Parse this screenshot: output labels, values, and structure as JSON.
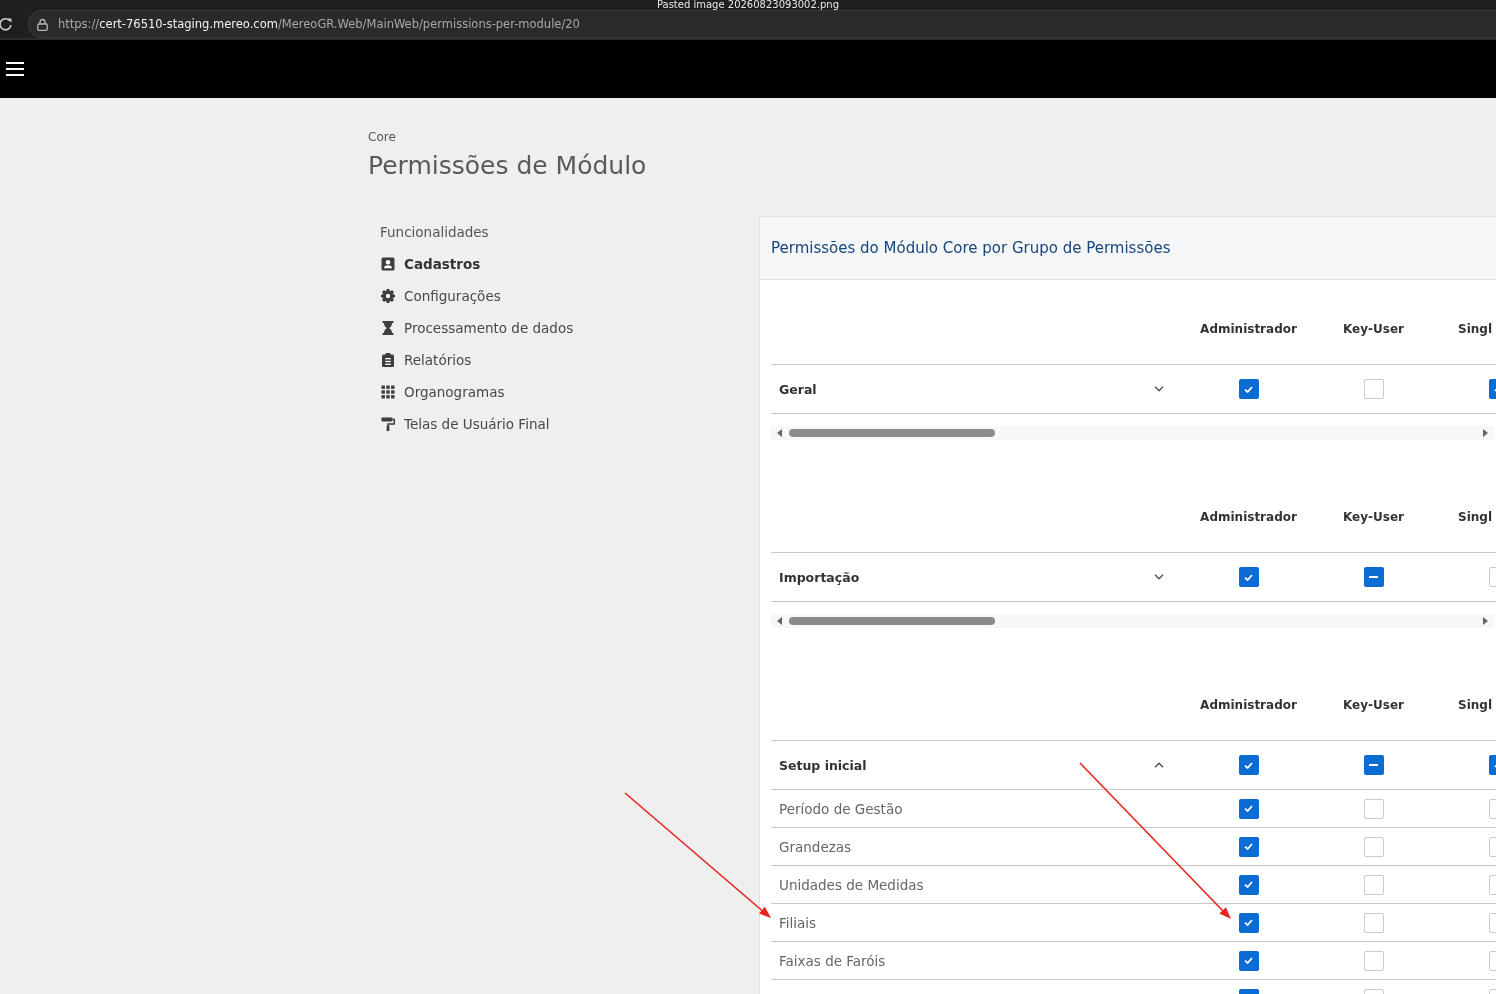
{
  "browser": {
    "tab_title": "Pasted image 20260823093002.png",
    "url_scheme": "https://",
    "url_host": "cert-76510-staging.mereo.com",
    "url_path": "/MereoGR.Web/MainWeb/permissions-per-module/20"
  },
  "breadcrumb": "Core",
  "page_title": "Permissões de Módulo",
  "sidebar": {
    "heading": "Funcionalidades",
    "items": [
      {
        "label": "Cadastros",
        "selected": true
      },
      {
        "label": "Configurações",
        "selected": false
      },
      {
        "label": "Processamento de dados",
        "selected": false
      },
      {
        "label": "Relatórios",
        "selected": false
      },
      {
        "label": "Organogramas",
        "selected": false
      },
      {
        "label": "Telas de Usuário Final",
        "selected": false
      }
    ]
  },
  "panel": {
    "title": "Permissões do Módulo Core por Grupo de Permissões",
    "sections": [
      {
        "columns": [
          "Administrador",
          "Key-User",
          "Singl"
        ],
        "group": {
          "label": "Geral",
          "expanded": false,
          "cells": [
            {
              "checked": true,
              "partial": false
            },
            {
              "checked": false,
              "partial": false
            },
            {
              "checked": true,
              "partial": false
            }
          ]
        }
      },
      {
        "columns": [
          "Administrador",
          "Key-User",
          "Singl"
        ],
        "group": {
          "label": "Importação",
          "expanded": false,
          "cells": [
            {
              "checked": true,
              "partial": false
            },
            {
              "checked": true,
              "partial": true
            },
            {
              "checked": false,
              "partial": false
            }
          ]
        }
      },
      {
        "columns": [
          "Administrador",
          "Key-User",
          "Singl"
        ],
        "group": {
          "label": "Setup inicial",
          "expanded": true,
          "cells": [
            {
              "checked": true,
              "partial": false
            },
            {
              "checked": true,
              "partial": true
            },
            {
              "checked": true,
              "partial": false
            }
          ],
          "children": [
            {
              "label": "Período de Gestão",
              "cells": [
                {
                  "checked": true,
                  "partial": false
                },
                {
                  "checked": false,
                  "partial": false
                },
                {
                  "checked": false,
                  "partial": false
                }
              ]
            },
            {
              "label": "Grandezas",
              "cells": [
                {
                  "checked": true,
                  "partial": false
                },
                {
                  "checked": false,
                  "partial": false
                },
                {
                  "checked": false,
                  "partial": false
                }
              ]
            },
            {
              "label": "Unidades de Medidas",
              "cells": [
                {
                  "checked": true,
                  "partial": false
                },
                {
                  "checked": false,
                  "partial": false
                },
                {
                  "checked": false,
                  "partial": false
                }
              ]
            },
            {
              "label": "Filiais",
              "cells": [
                {
                  "checked": true,
                  "partial": false
                },
                {
                  "checked": false,
                  "partial": false
                },
                {
                  "checked": false,
                  "partial": false
                }
              ]
            },
            {
              "label": "Faixas de Faróis",
              "cells": [
                {
                  "checked": true,
                  "partial": false
                },
                {
                  "checked": false,
                  "partial": false
                },
                {
                  "checked": false,
                  "partial": false
                }
              ]
            },
            {
              "cells": [
                {
                  "checked": true,
                  "partial": false
                },
                {
                  "checked": false,
                  "partial": false
                },
                {
                  "checked": false,
                  "partial": false
                }
              ]
            }
          ]
        }
      }
    ]
  }
}
